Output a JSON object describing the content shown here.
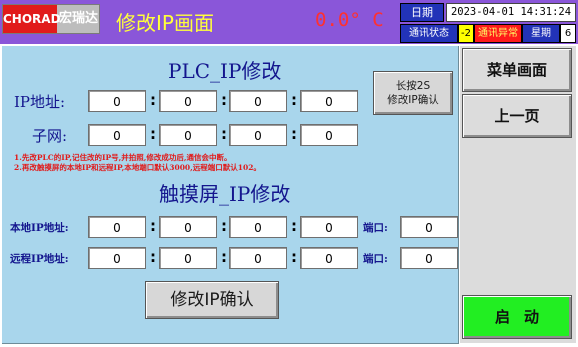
{
  "header": {
    "logo_brand": "CHORAD",
    "logo_cname": "宏瑞达",
    "page_title": "修改IP画面",
    "temperature": "0.0° C",
    "date_label": "日期",
    "date_value": "2023-04-01 14:31:24",
    "comm_label": "通讯状态",
    "comm_code": "-2",
    "comm_status": "通讯异常",
    "week_label": "星期",
    "week_value": "6"
  },
  "plc": {
    "title": "PLC_IP修改",
    "ip_label": "IP地址:",
    "ip": [
      "0",
      "0",
      "0",
      "0"
    ],
    "mask_label": "子网:",
    "mask": [
      "0",
      "0",
      "0",
      "0"
    ],
    "long_press_button": "长按2S\n修改IP确认"
  },
  "notes": [
    "1.先改PLC的IP,记住改的IP号,并拍照,修改成功后,通信会中断。",
    "2.再改触摸屏的本地IP和远程IP,本地端口默认3000,远程端口默认102。"
  ],
  "hmi": {
    "title": "触摸屏_IP修改",
    "local_label": "本地IP地址:",
    "local_ip": [
      "0",
      "0",
      "0",
      "0"
    ],
    "remote_label": "远程IP地址:",
    "remote_ip": [
      "0",
      "0",
      "0",
      "0"
    ],
    "port_label": "端口:",
    "local_port": "0",
    "remote_port": "0",
    "confirm_button": "修改IP确认"
  },
  "side_menu": {
    "menu_page": "菜单画面",
    "prev_page": "上一页",
    "start": "启动"
  },
  "colors": {
    "header_bg": "#8a56d9",
    "panel_bg": "#a9d6ec",
    "title_text": "#ffff3b",
    "alarm_red": "#ff1a1a",
    "start_green": "#22ee22"
  }
}
